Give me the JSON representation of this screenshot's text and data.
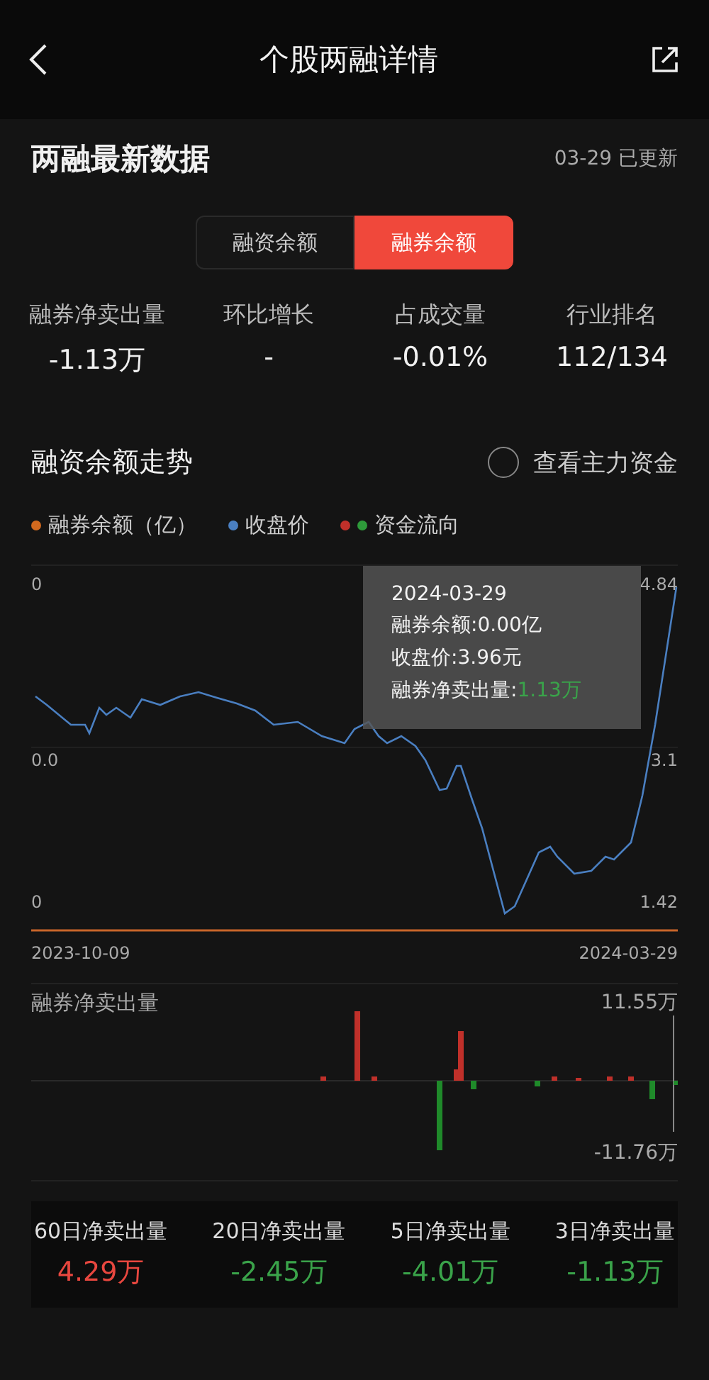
{
  "header": {
    "title": "个股两融详情"
  },
  "latest": {
    "title": "两融最新数据",
    "updated": "03-29 已更新"
  },
  "tabs": [
    {
      "label": "融资余额",
      "selected": false
    },
    {
      "label": "融券余额",
      "selected": true
    }
  ],
  "stats": [
    {
      "label": "融券净卖出量",
      "value": "-1.13万"
    },
    {
      "label": "环比增长",
      "value": "-"
    },
    {
      "label": "占成交量",
      "value": "-0.01%"
    },
    {
      "label": "行业排名",
      "value": "112/134"
    }
  ],
  "trend": {
    "title": "融资余额走势",
    "toggle": {
      "label": "查看主力资金",
      "checked": false
    }
  },
  "legend": [
    {
      "label": "融券余额（亿）",
      "dots": [
        {
          "color": "#d2691e"
        }
      ]
    },
    {
      "label": "收盘价",
      "dots": [
        {
          "color": "#4a7fc1"
        }
      ]
    },
    {
      "label": "资金流向",
      "dots": [
        {
          "color": "#c0302a"
        },
        {
          "color": "#2e9a3a"
        }
      ]
    }
  ],
  "price_chart": {
    "left_ticks": [
      "0",
      "0.0",
      "0"
    ],
    "right_ticks": [
      "4.84",
      "3.1",
      "1.42"
    ],
    "x_start": "2023-10-09",
    "x_end": "2024-03-29",
    "tooltip": {
      "date": "2024-03-29",
      "lines": [
        {
          "label": "融券余额:",
          "value": "0.00亿",
          "color": "#f2f2f2"
        },
        {
          "label": "收盘价:",
          "value": "3.96元",
          "color": "#f2f2f2"
        },
        {
          "label": "融券净卖出量:",
          "value": "1.13万",
          "color": "#3aa34a"
        }
      ]
    }
  },
  "volume_chart": {
    "title": "融券净卖出量",
    "max": "11.55万",
    "min": "-11.76万"
  },
  "summary": [
    {
      "label": "60日净卖出量",
      "value": "4.29万",
      "color": "#e8473f"
    },
    {
      "label": "20日净卖出量",
      "value": "-2.45万",
      "color": "#3aa34a"
    },
    {
      "label": "5日净卖出量",
      "value": "-4.01万",
      "color": "#3aa34a"
    },
    {
      "label": "3日净卖出量",
      "value": "-1.13万",
      "color": "#3aa34a"
    }
  ]
}
